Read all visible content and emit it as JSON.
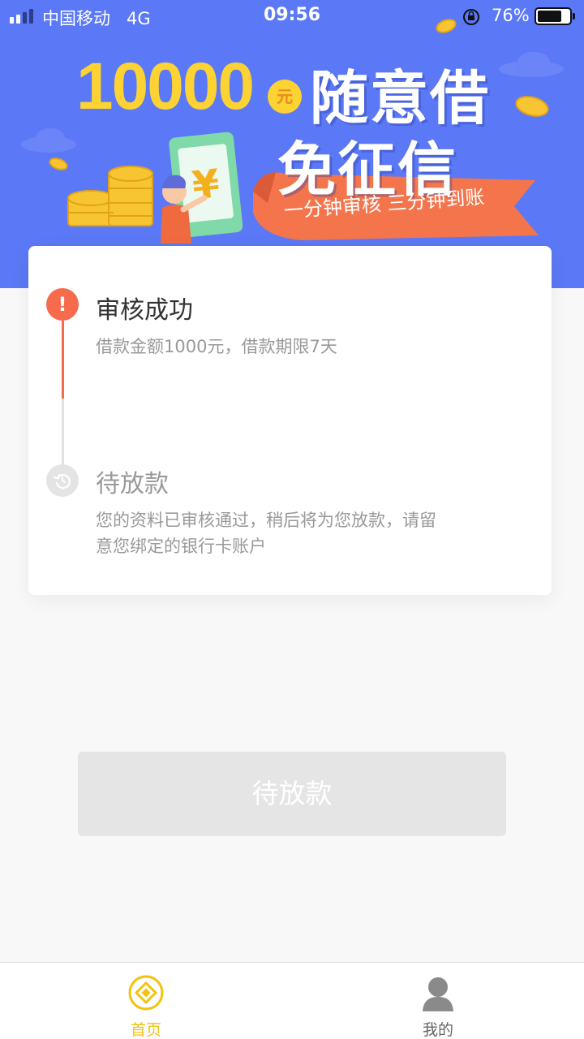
{
  "status_bar": {
    "carrier": "中国移动",
    "network": "4G",
    "time": "09:56",
    "battery_percent": "76%",
    "battery_level": 0.76
  },
  "banner": {
    "amount": "10000",
    "amount_unit": "元",
    "slogan_line1": "随意借",
    "slogan_line2": "免征信",
    "ribbon_text": "一分钟审核 三分钟到账",
    "background_color": "#5b78f6",
    "accent_color": "#fdd233"
  },
  "progress": {
    "steps": [
      {
        "title": "审核成功",
        "description": "借款金额1000元，借款期限7天",
        "status": "done",
        "icon": "exclamation-icon"
      },
      {
        "title": "待放款",
        "description_line1": "您的资料已审核通过，稍后将为您放款，请留",
        "description_line2": "意您绑定的银行卡账户",
        "status": "pending",
        "icon": "refresh-icon"
      }
    ],
    "active_color": "#f56b4c"
  },
  "main_button": {
    "label": "待放款",
    "enabled": false
  },
  "tab_bar": {
    "items": [
      {
        "label": "首页",
        "icon": "home-coin-icon",
        "active": true,
        "color": "#f2c30b"
      },
      {
        "label": "我的",
        "icon": "person-icon",
        "active": false
      }
    ]
  }
}
